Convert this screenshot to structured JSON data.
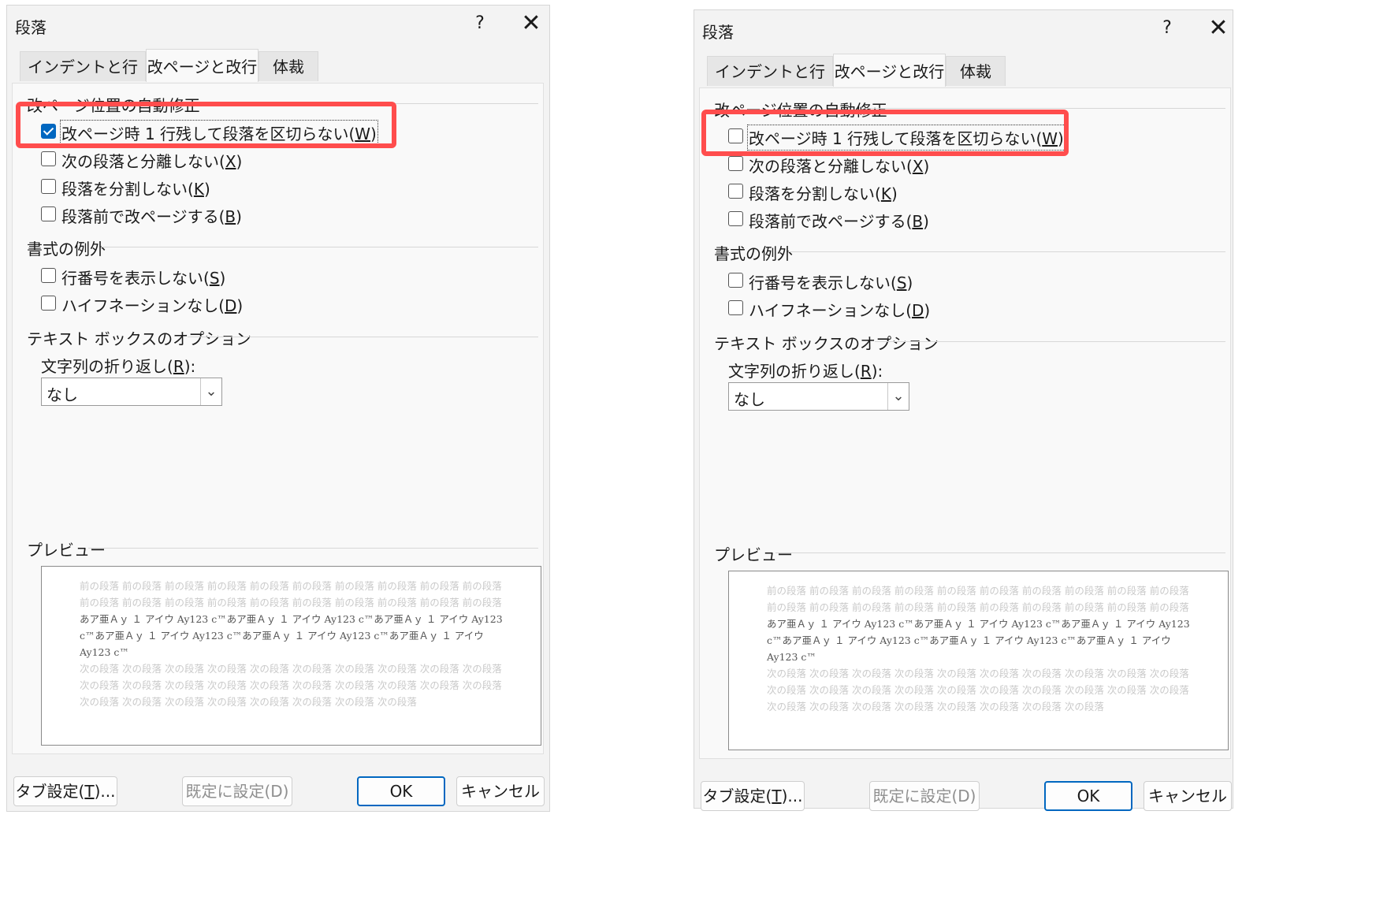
{
  "left": {
    "title": "段落",
    "help": "?",
    "close": "✕",
    "tabs": [
      "インデントと行間隔",
      "改ページと改行",
      "体裁"
    ],
    "pagination": {
      "heading": "改ページ位置の自動修正",
      "widow_pre": "改ページ時 1 行残して段落を区切らない(",
      "widow_key": "W",
      "keep_next_pre": "次の段落と分離しない(",
      "keep_next_key": "X",
      "keep_lines_pre": "段落を分割しない(",
      "keep_lines_key": "K",
      "page_break_pre": "段落前で改ページする(",
      "page_break_key": "B",
      "close_paren": ")"
    },
    "exceptions": {
      "heading": "書式の例外",
      "line_numbers_pre": "行番号を表示しない(",
      "line_numbers_key": "S",
      "hyphenation_pre": "ハイフネーションなし(",
      "hyphenation_key": "D"
    },
    "textbox": {
      "heading": "テキスト ボックスのオプション",
      "wrap_label_pre": "文字列の折り返し(",
      "wrap_key": "R",
      "wrap_label_post": "):",
      "wrap_value": "なし"
    },
    "preview": {
      "heading": "プレビュー",
      "prev_text": "前の段落 前の段落 前の段落 前の段落 前の段落 前の段落 前の段落 前の段落 前の段落 前の段落 前の段落 前の段落 前の段落 前の段落 前の段落 前の段落 前の段落 前の段落 前の段落 前の段落",
      "cur_text": "あア亜Ａｙ １ アイウ Ay123 c™あア亜Ａｙ １ アイウ Ay123 c™あア亜Ａｙ １ アイウ Ay123 c™あア亜Ａｙ １ アイウ Ay123 c™あア亜Ａｙ １ アイウ Ay123 c™あア亜Ａｙ １ アイウ Ay123 c™",
      "next_text": "次の段落 次の段落 次の段落 次の段落 次の段落 次の段落 次の段落 次の段落 次の段落 次の段落 次の段落 次の段落 次の段落 次の段落 次の段落 次の段落 次の段落 次の段落 次の段落 次の段落 次の段落 次の段落 次の段落 次の段落 次の段落 次の段落 次の段落 次の段落"
    },
    "buttons": {
      "tabs_pre": "タブ設定(",
      "tabs_key": "T",
      "tabs_post": ")...",
      "default": "既定に設定(D)",
      "ok": "OK",
      "cancel": "キャンセル"
    },
    "widow_checked": true
  },
  "right": {
    "title": "段落",
    "help": "?",
    "close": "✕",
    "tabs": [
      "インデントと行間隔",
      "改ページと改行",
      "体裁"
    ],
    "pagination": {
      "heading": "改ページ位置の自動修正",
      "widow_pre": "改ページ時 1 行残して段落を区切らない(",
      "widow_key": "W",
      "keep_next_pre": "次の段落と分離しない(",
      "keep_next_key": "X",
      "keep_lines_pre": "段落を分割しない(",
      "keep_lines_key": "K",
      "page_break_pre": "段落前で改ページする(",
      "page_break_key": "B",
      "close_paren": ")"
    },
    "exceptions": {
      "heading": "書式の例外",
      "line_numbers_pre": "行番号を表示しない(",
      "line_numbers_key": "S",
      "hyphenation_pre": "ハイフネーションなし(",
      "hyphenation_key": "D"
    },
    "textbox": {
      "heading": "テキスト ボックスのオプション",
      "wrap_label_pre": "文字列の折り返し(",
      "wrap_key": "R",
      "wrap_label_post": "):",
      "wrap_value": "なし"
    },
    "preview": {
      "heading": "プレビュー",
      "prev_text": "前の段落 前の段落 前の段落 前の段落 前の段落 前の段落 前の段落 前の段落 前の段落 前の段落 前の段落 前の段落 前の段落 前の段落 前の段落 前の段落 前の段落 前の段落 前の段落 前の段落",
      "cur_text": "あア亜Ａｙ １ アイウ Ay123 c™あア亜Ａｙ １ アイウ Ay123 c™あア亜Ａｙ １ アイウ Ay123 c™あア亜Ａｙ １ アイウ Ay123 c™あア亜Ａｙ １ アイウ Ay123 c™あア亜Ａｙ １ アイウ Ay123 c™",
      "next_text": "次の段落 次の段落 次の段落 次の段落 次の段落 次の段落 次の段落 次の段落 次の段落 次の段落 次の段落 次の段落 次の段落 次の段落 次の段落 次の段落 次の段落 次の段落 次の段落 次の段落 次の段落 次の段落 次の段落 次の段落 次の段落 次の段落 次の段落 次の段落"
    },
    "buttons": {
      "tabs_pre": "タブ設定(",
      "tabs_key": "T",
      "tabs_post": ")...",
      "default": "既定に設定(D)",
      "ok": "OK",
      "cancel": "キャンセル"
    },
    "widow_checked": false
  },
  "colors": {
    "highlight": "#ff4d4d",
    "accent": "#0067c0"
  }
}
